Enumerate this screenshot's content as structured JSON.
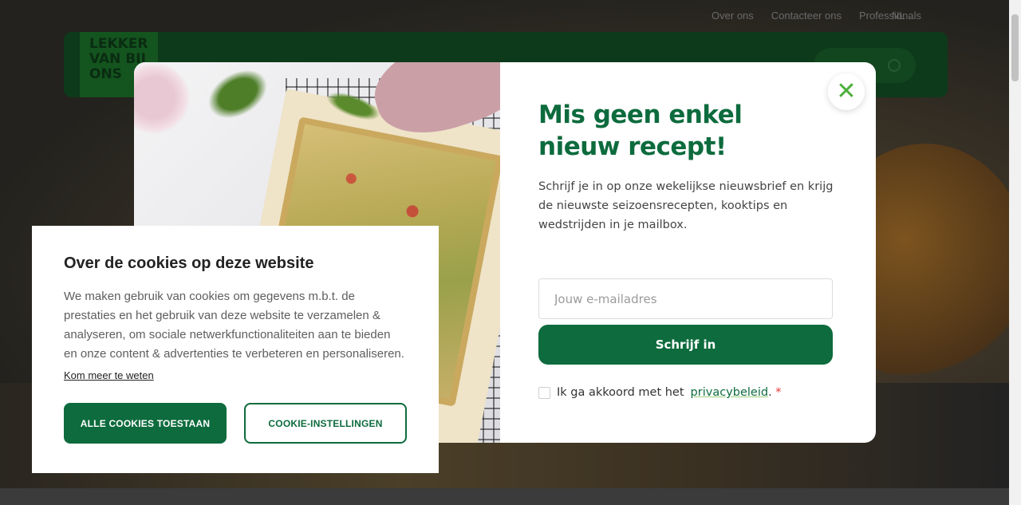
{
  "header": {
    "top_links": [
      "Over ons",
      "Contacteer ons",
      "Professionals"
    ],
    "language": "NL",
    "logo_lines": [
      "LEKKER",
      "VAN BIJ",
      "ONS"
    ]
  },
  "newsletter_modal": {
    "title": "Mis geen enkel nieuw recept!",
    "description": "Schrijf je in op onze wekelijkse nieuwsbrief en krijg de nieuwste seizoensrecepten, kooktips en wedstrijden in je mailbox.",
    "email_placeholder": "Jouw e-mailadres",
    "submit_label": "Schrijf in",
    "consent_prefix": "Ik ga akkoord met het",
    "consent_link": "privacybeleid",
    "consent_suffix": ".",
    "required_mark": "*",
    "close_symbol": "✕"
  },
  "cookie_banner": {
    "title": "Over de cookies op deze website",
    "text": "We maken gebruik van cookies om gegevens m.b.t. de prestaties en het gebruik van deze website te verzamelen & analyseren, om sociale netwerkfunctionaliteiten aan te bieden en onze content & advertenties te verbeteren en personaliseren.",
    "learn_more": "Kom meer te weten",
    "accept_label": "ALLE COOKIES TOESTAAN",
    "settings_label": "COOKIE-INSTELLINGEN"
  },
  "colors": {
    "brand_green": "#0d6b3d",
    "close_green": "#4caf3a",
    "required_red": "#ee3333"
  }
}
